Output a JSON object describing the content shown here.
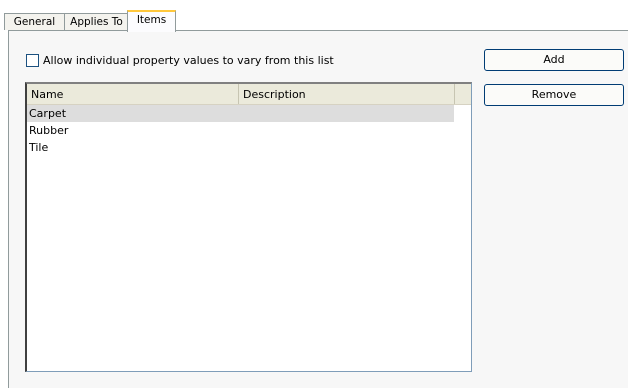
{
  "tabs": [
    {
      "label": "General"
    },
    {
      "label": "Applies To"
    },
    {
      "label": "Items"
    }
  ],
  "active_tab": "Items",
  "checkbox": {
    "label": "Allow individual property values to vary from this list",
    "checked": false
  },
  "list": {
    "columns": [
      "Name",
      "Description"
    ],
    "rows": [
      {
        "name": "Carpet",
        "description": "",
        "selected": true
      },
      {
        "name": "Rubber",
        "description": "",
        "selected": false
      },
      {
        "name": "Tile",
        "description": "",
        "selected": false
      }
    ]
  },
  "buttons": {
    "add_label": "Add",
    "remove_label": "Remove"
  },
  "colors": {
    "active_tab_accent": "#ffc83c",
    "button_border": "#003c74",
    "selected_row": "#dddddd"
  }
}
